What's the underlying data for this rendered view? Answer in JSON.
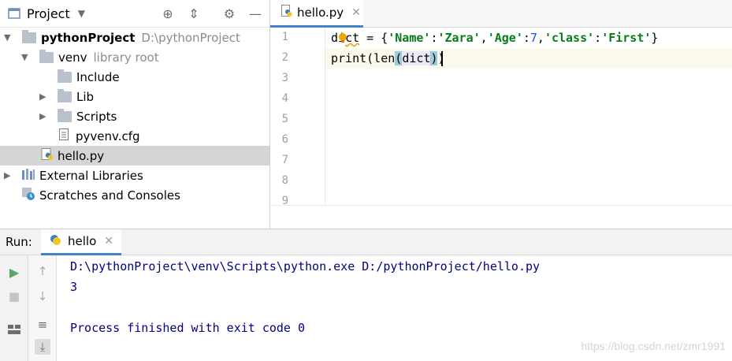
{
  "project": {
    "title": "Project",
    "tree": [
      {
        "label": "pythonProject",
        "hint": "D:\\pythonProject"
      },
      {
        "label": "venv",
        "hint": "library root"
      },
      {
        "label": "Include"
      },
      {
        "label": "Lib"
      },
      {
        "label": "Scripts"
      },
      {
        "label": "pyvenv.cfg"
      },
      {
        "label": "hello.py"
      },
      {
        "label": "External Libraries"
      },
      {
        "label": "Scratches and Consoles"
      }
    ]
  },
  "editor": {
    "tab_label": "hello.py",
    "line_numbers": [
      "1",
      "2",
      "3",
      "4",
      "5",
      "6",
      "7",
      "8",
      "9"
    ],
    "line1": {
      "a": "di",
      "b": "ct",
      "c": " = {",
      "s1": "'Name'",
      "c1": ":",
      "s2": "'Zara'",
      "c2": ",",
      "s3": "'Age'",
      "c3": ":",
      "n1": "7",
      "c4": ",",
      "s4": "'class'",
      "c5": ":",
      "s5": "'First'",
      "c6": "}"
    },
    "line2": {
      "a": "print(len",
      "b": "(",
      "c": "dict",
      "d": ")",
      "e": ")"
    }
  },
  "run": {
    "label": "Run:",
    "tab_label": "hello",
    "output": [
      "D:\\pythonProject\\venv\\Scripts\\python.exe D:/pythonProject/hello.py",
      "3",
      "",
      "Process finished with exit code 0"
    ]
  },
  "watermark": "https://blog.csdn.net/zmr1991",
  "colors": {
    "accent": "#4083c9",
    "string": "#067d17",
    "number": "#1750eb",
    "console": "#000080",
    "run_green": "#59a869"
  }
}
